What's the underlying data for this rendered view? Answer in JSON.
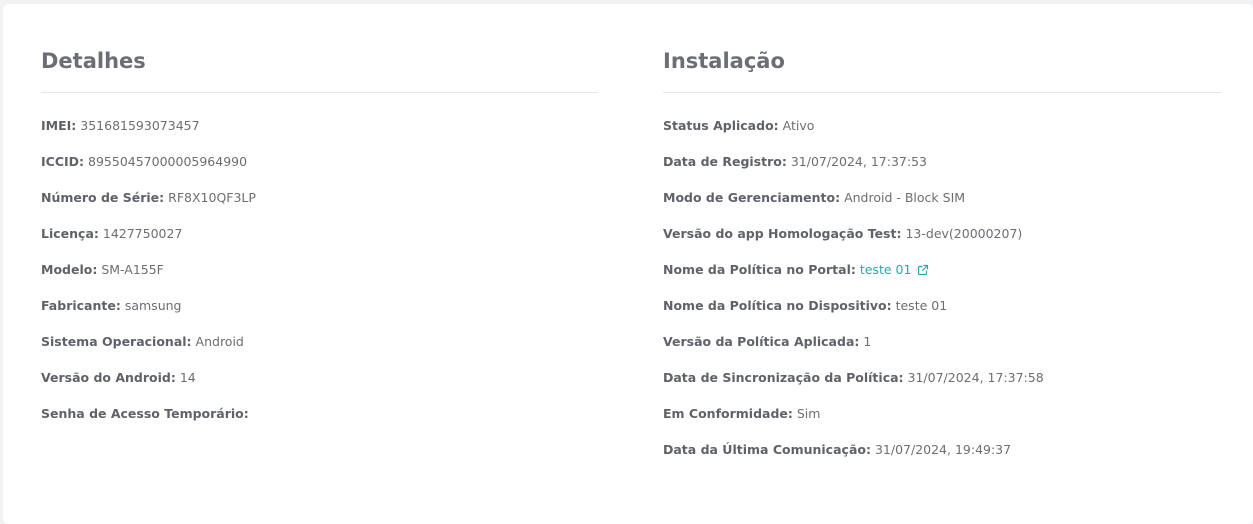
{
  "detalhes": {
    "title": "Detalhes",
    "fields": [
      {
        "label": "IMEI:",
        "value": "351681593073457"
      },
      {
        "label": "ICCID:",
        "value": "89550457000005964990"
      },
      {
        "label": "Número de Série:",
        "value": "RF8X10QF3LP"
      },
      {
        "label": "Licença:",
        "value": "1427750027"
      },
      {
        "label": "Modelo:",
        "value": "SM-A155F"
      },
      {
        "label": "Fabricante:",
        "value": "samsung"
      },
      {
        "label": "Sistema Operacional:",
        "value": "Android"
      },
      {
        "label": "Versão do Android:",
        "value": "14"
      },
      {
        "label": "Senha de Acesso Temporário:",
        "value": ""
      }
    ]
  },
  "instalacao": {
    "title": "Instalação",
    "fields": [
      {
        "label": "Status Aplicado:",
        "value": "Ativo"
      },
      {
        "label": "Data de Registro:",
        "value": "31/07/2024, 17:37:53"
      },
      {
        "label": "Modo de Gerenciamento:",
        "value": "Android - Block SIM"
      },
      {
        "label": "Versão do app Homologação Test:",
        "value": "13-dev(20000207)"
      },
      {
        "label": "Nome da Política no Portal:",
        "value": "teste 01",
        "icon": "external-link-icon"
      },
      {
        "label": "Nome da Política no Dispositivo:",
        "value": "teste 01"
      },
      {
        "label": "Versão da Política Aplicada:",
        "value": "1"
      },
      {
        "label": "Data de Sincronização da Política:",
        "value": "31/07/2024, 17:37:58"
      },
      {
        "label": "Em Conformidade:",
        "value": "Sim"
      },
      {
        "label": "Data da Última Comunicação:",
        "value": "31/07/2024, 19:49:37"
      }
    ]
  },
  "colors": {
    "link": "#2aa7b3",
    "text": "#6b6e75",
    "divider": "#e3e5e8",
    "background": "#f1f2f4"
  }
}
